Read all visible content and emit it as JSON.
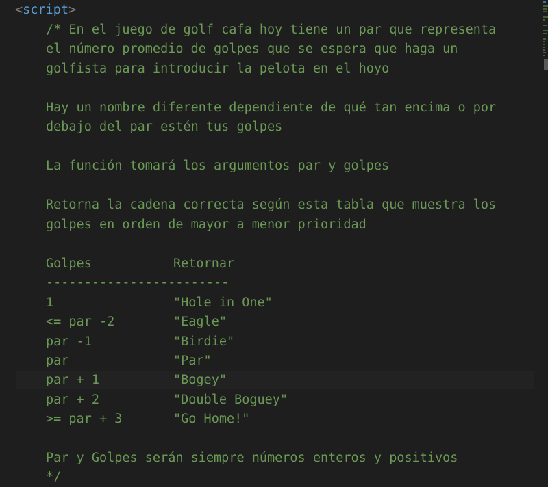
{
  "editor": {
    "open_tag": {
      "open_bracket": "<",
      "name": "script",
      "close_bracket": ">"
    },
    "comment_lines": [
      "/* En el juego de golf cafa hoy tiene un par que representa",
      "el número promedio de golpes que se espera que haga un",
      "golfista para introducir la pelota en el hoyo",
      "",
      "Hay un nombre diferente dependiente de qué tan encima o por",
      "debajo del par estén tus golpes",
      "",
      "La función tomará los argumentos par y golpes",
      "",
      "Retorna la cadena correcta según esta tabla que muestra los",
      "golpes en orden de mayor a menor prioridad",
      ""
    ],
    "table": {
      "header": {
        "col1": "Golpes",
        "col2": "Retornar"
      },
      "separator": "------------------------",
      "rows": [
        {
          "golpes": "1",
          "retornar": "\"Hole in One\""
        },
        {
          "golpes": "<= par -2",
          "retornar": "\"Eagle\""
        },
        {
          "golpes": "par -1",
          "retornar": "\"Birdie\""
        },
        {
          "golpes": "par",
          "retornar": "\"Par\""
        },
        {
          "golpes": "par + 1",
          "retornar": "\"Bogey\""
        },
        {
          "golpes": "par + 2",
          "retornar": "\"Double Boguey\""
        },
        {
          "golpes": ">= par + 3",
          "retornar": "\"Go Home!\""
        }
      ]
    },
    "closing_lines": [
      "",
      "Par y Golpes serán siempre números enteros y positivos",
      "*/"
    ],
    "colors": {
      "background": "#1e1e1e",
      "comment": "#6a9955",
      "tag_bracket": "#808080",
      "tag_name": "#569cd6"
    }
  }
}
